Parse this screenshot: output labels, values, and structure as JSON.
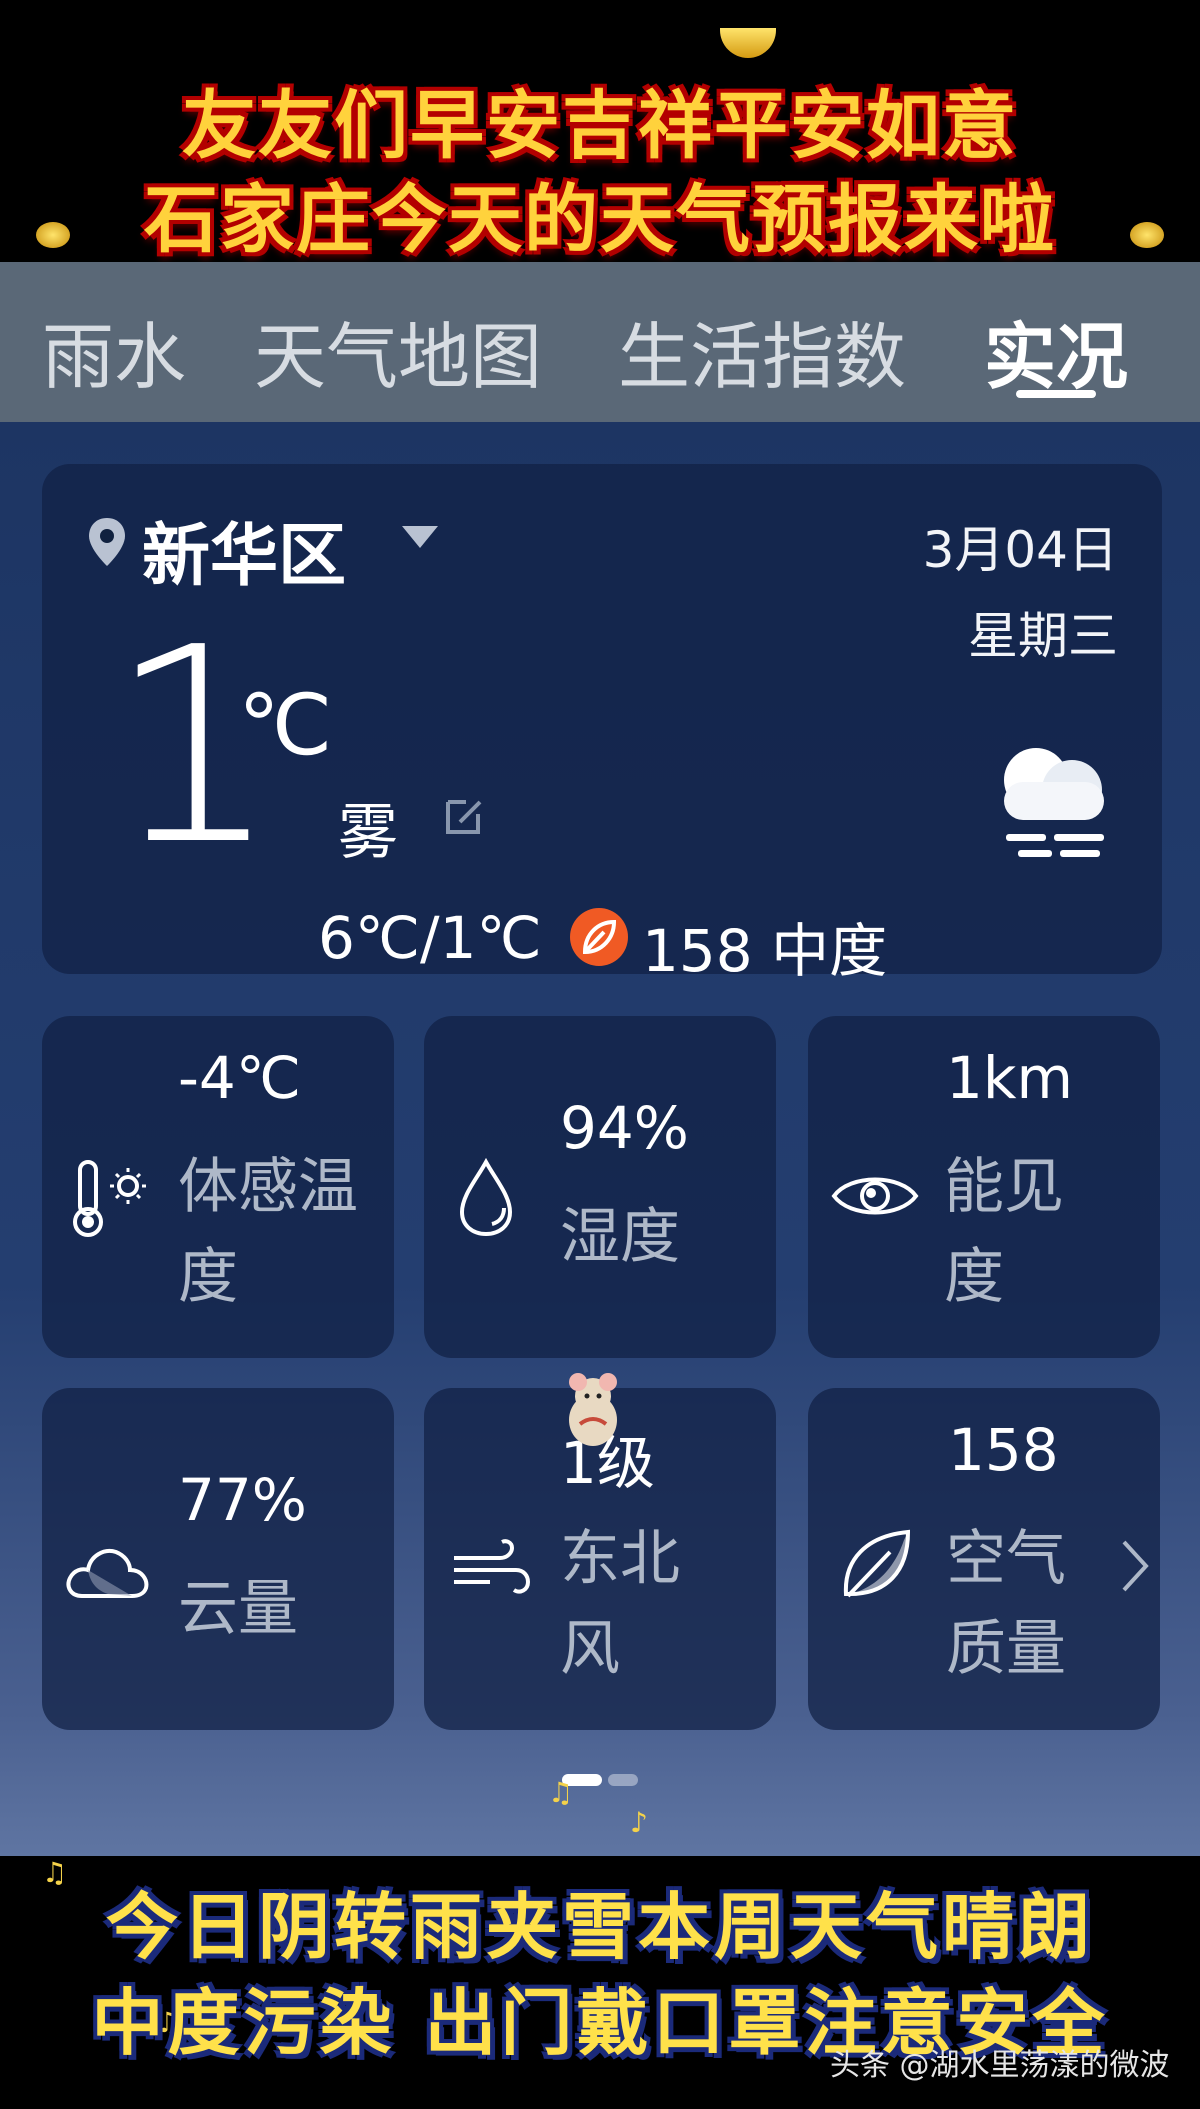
{
  "banner": {
    "line1": "友友们早安吉祥平安如意",
    "line2": "石家庄今天的天气预报来啦"
  },
  "tabs": [
    {
      "label": "雨水"
    },
    {
      "label": "天气地图"
    },
    {
      "label": "生活指数"
    },
    {
      "label": "实况",
      "active": true
    }
  ],
  "current": {
    "location": "新华区",
    "date": "3月04日",
    "weekday": "星期三",
    "temperature": "1",
    "unit": "℃",
    "condition": "雾",
    "range": "6℃/1℃",
    "aqi": "158 中度",
    "weather_icon": "fog-icon"
  },
  "tiles": {
    "feels_like": {
      "value": "-4℃",
      "label": "体感温度",
      "icon": "thermometer-sun-icon"
    },
    "humidity": {
      "value": "94%",
      "label": "湿度",
      "icon": "water-drop-icon"
    },
    "visibility": {
      "value": "1km",
      "label": "能见度",
      "icon": "eye-icon"
    },
    "cloud": {
      "value": "77%",
      "label": "云量",
      "icon": "cloud-icon"
    },
    "wind": {
      "value": "1级",
      "label": "东北风",
      "icon": "wind-icon"
    },
    "air": {
      "value": "158",
      "label": "空气质量",
      "icon": "leaf-icon"
    }
  },
  "subtitles": {
    "line1": "今日阴转雨夹雪本周天气晴朗",
    "line2": "中度污染  出门戴口罩注意安全"
  },
  "watermark": "头条 @湖水里荡漾的微波",
  "colors": {
    "tab_bar": "#5a6877",
    "app_bg": "#1d3563",
    "aqi": "#f05a24",
    "banner_text": "#ffd23c"
  }
}
